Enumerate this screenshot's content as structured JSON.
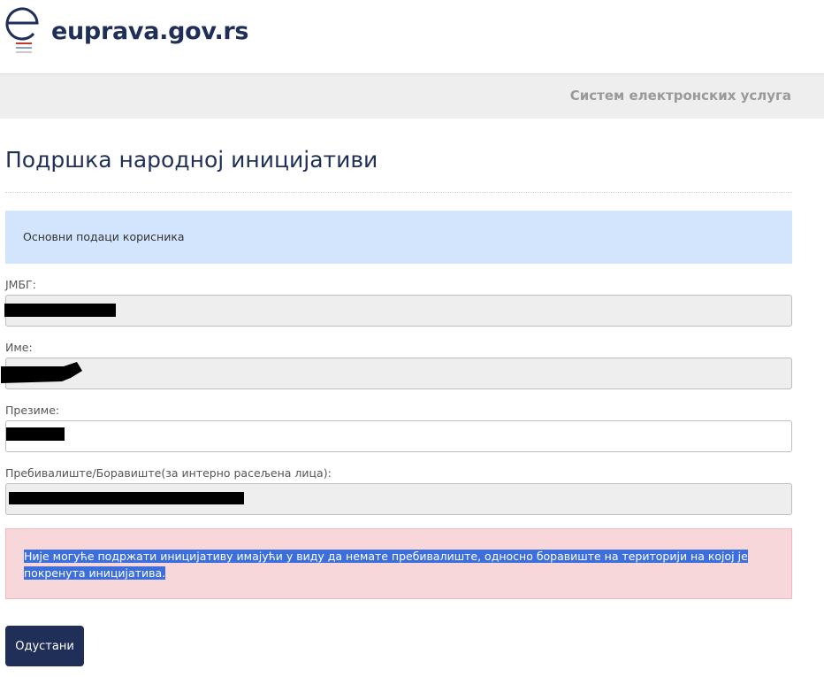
{
  "header": {
    "logo_text": "euprava.gov.rs",
    "band_text": "Систем електронских услуга"
  },
  "page": {
    "title": "Подршка народној иницијативи",
    "section_title": "Основни подаци корисника"
  },
  "form": {
    "jmbg_label": "ЈМБГ:",
    "jmbg_value": "",
    "ime_label": "Име:",
    "ime_value": "",
    "prezime_label": "Презиме:",
    "prezime_value": "",
    "prebivaliste_label": "Пребивалиште/Боравиште(за интерно расељена лица):",
    "prebivaliste_value": ""
  },
  "alert": {
    "text": "Није могуће подржати иницијативу имајући у виду да немате пребивалиште, односно боравиште на територији на којој је покренута иницијатива."
  },
  "actions": {
    "cancel_label": "Одустани"
  },
  "colors": {
    "brand": "#1f2f57",
    "info_bg": "#d2e5fd",
    "error_bg": "#f8d7da",
    "selection": "#3c6fdc"
  }
}
